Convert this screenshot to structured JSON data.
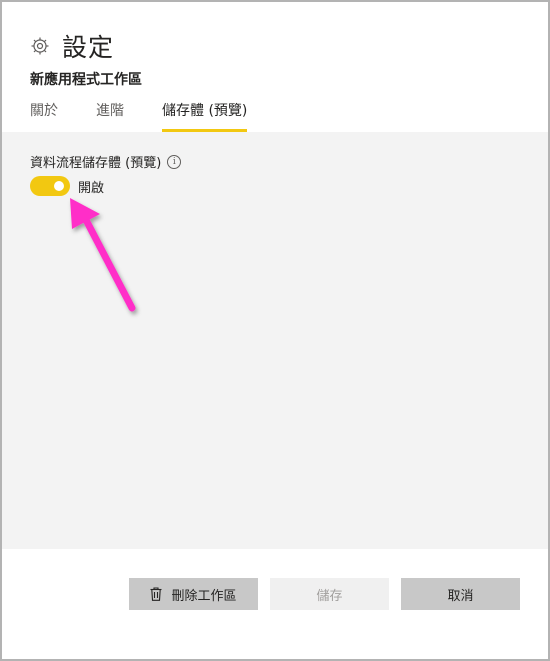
{
  "header": {
    "title": "設定",
    "subtitle": "新應用程式工作區",
    "icon": "gear-icon"
  },
  "tabs": [
    {
      "label": "關於",
      "active": false
    },
    {
      "label": "進階",
      "active": false
    },
    {
      "label": "儲存體 (預覽)",
      "active": true
    }
  ],
  "content": {
    "section_label": "資料流程儲存體 (預覽)",
    "info_glyph": "i",
    "toggle": {
      "label": "開啟",
      "on": true
    }
  },
  "footer": {
    "delete_label": "刪除工作區",
    "save_label": "儲存",
    "cancel_label": "取消"
  },
  "colors": {
    "accent": "#f2c811",
    "arrow": "#ff2fc8",
    "content_bg": "#f3f3f3",
    "button_bg": "#c8c8c8"
  }
}
